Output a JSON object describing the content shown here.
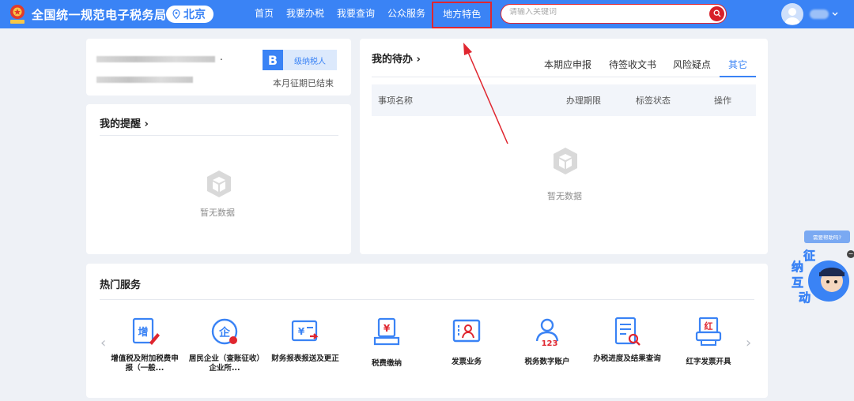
{
  "header": {
    "site_title": "全国统一规范电子税务局",
    "city": "北京",
    "nav": [
      "首页",
      "我要办税",
      "我要查询",
      "公众服务",
      "地方特色"
    ],
    "search_placeholder": "请输入关键词"
  },
  "account": {
    "taxpayer_grade_letter": "B",
    "taxpayer_grade_label": "级纳税人",
    "period_status": "本月征期已结束",
    "name_suffix": "."
  },
  "reminders": {
    "title": "我的提醒",
    "chevron": "›",
    "empty_text": "暂无数据"
  },
  "todo": {
    "title": "我的待办",
    "chevron": "›",
    "tabs": [
      "本期应申报",
      "待签收文书",
      "风险疑点",
      "其它"
    ],
    "active_tab": "其它",
    "columns": [
      "事项名称",
      "办理期限",
      "标签状态",
      "操作"
    ],
    "empty_text": "暂无数据"
  },
  "hot_services": {
    "title": "热门服务",
    "prev": "‹",
    "next": "›",
    "items": [
      {
        "label": "增值税及附加税费申报（一般...",
        "icon": "vat-declare-icon",
        "glyph": "增"
      },
      {
        "label": "居民企业（查账征收）企业所...",
        "icon": "enterprise-income-tax-icon",
        "glyph": "企"
      },
      {
        "label": "财务报表报送及更正",
        "icon": "financial-report-icon",
        "glyph": "¥"
      },
      {
        "label": "税费缴纳",
        "icon": "tax-payment-icon",
        "glyph": "¥"
      },
      {
        "label": "发票业务",
        "icon": "invoice-business-icon",
        "glyph": ""
      },
      {
        "label": "税务数字账户",
        "icon": "tax-digital-account-icon",
        "glyph": "123"
      },
      {
        "label": "办税进度及结果查询",
        "icon": "progress-query-icon",
        "glyph": ""
      },
      {
        "label": "红字发票开具",
        "icon": "red-invoice-icon",
        "glyph": "红"
      }
    ]
  },
  "help": {
    "bubble": "需要帮助吗?",
    "widget_text": [
      "征",
      "纳",
      "互",
      "动"
    ],
    "close": "−"
  },
  "colors": {
    "primary": "#3a83f5",
    "highlight_red": "#e0262f",
    "background": "#eef1f6"
  }
}
